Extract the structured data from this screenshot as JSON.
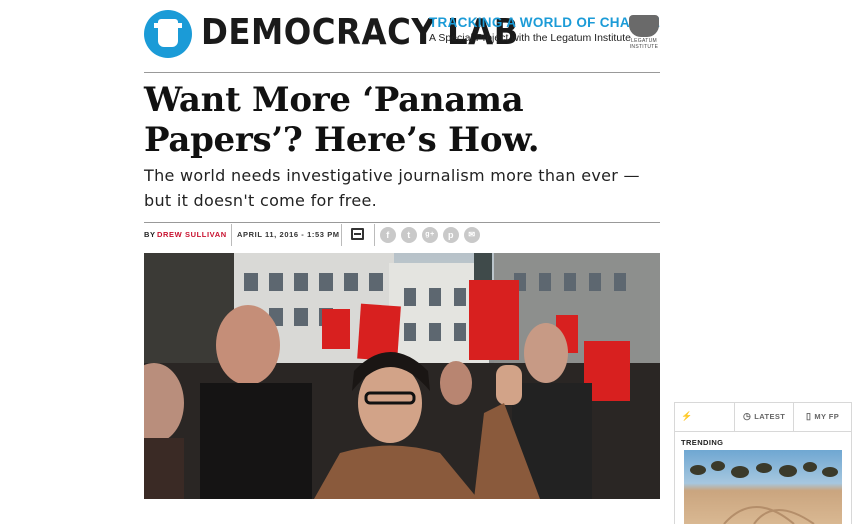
{
  "header": {
    "logo_text": "DEMOCRACY LAB",
    "tagline_top": "TRACKING A WORLD OF CHANGE",
    "tagline_bottom": "A Special Project with the Legatum Institute",
    "partner_logo_text": "LEGATUM INSTITUTE"
  },
  "article": {
    "headline": "Want More ‘Panama Papers’? Here’s How.",
    "subhead": "The world needs investigative journalism more than ever — but it doesn't come for free.",
    "byline_prefix": "BY",
    "author": "DREW SULLIVAN",
    "date": "APRIL 11, 2016 - 1:53 PM",
    "share_icons": [
      "facebook-icon",
      "twitter-icon",
      "google-plus-icon",
      "pinterest-icon",
      "email-icon"
    ],
    "share_glyphs": [
      "f",
      "t",
      "g+",
      "p",
      "✉"
    ]
  },
  "sidebar_widget": {
    "tabs": [
      {
        "label": "TRENDING",
        "icon": "lightning-icon",
        "glyph": "⚡"
      },
      {
        "label": "LATEST",
        "icon": "clock-icon",
        "glyph": "◷"
      },
      {
        "label": "MY FP",
        "icon": "page-icon",
        "glyph": "▯"
      }
    ]
  },
  "colors": {
    "brand_blue": "#1b9bd7",
    "author_red": "#c8102e",
    "sign_red": "#d8201f"
  }
}
